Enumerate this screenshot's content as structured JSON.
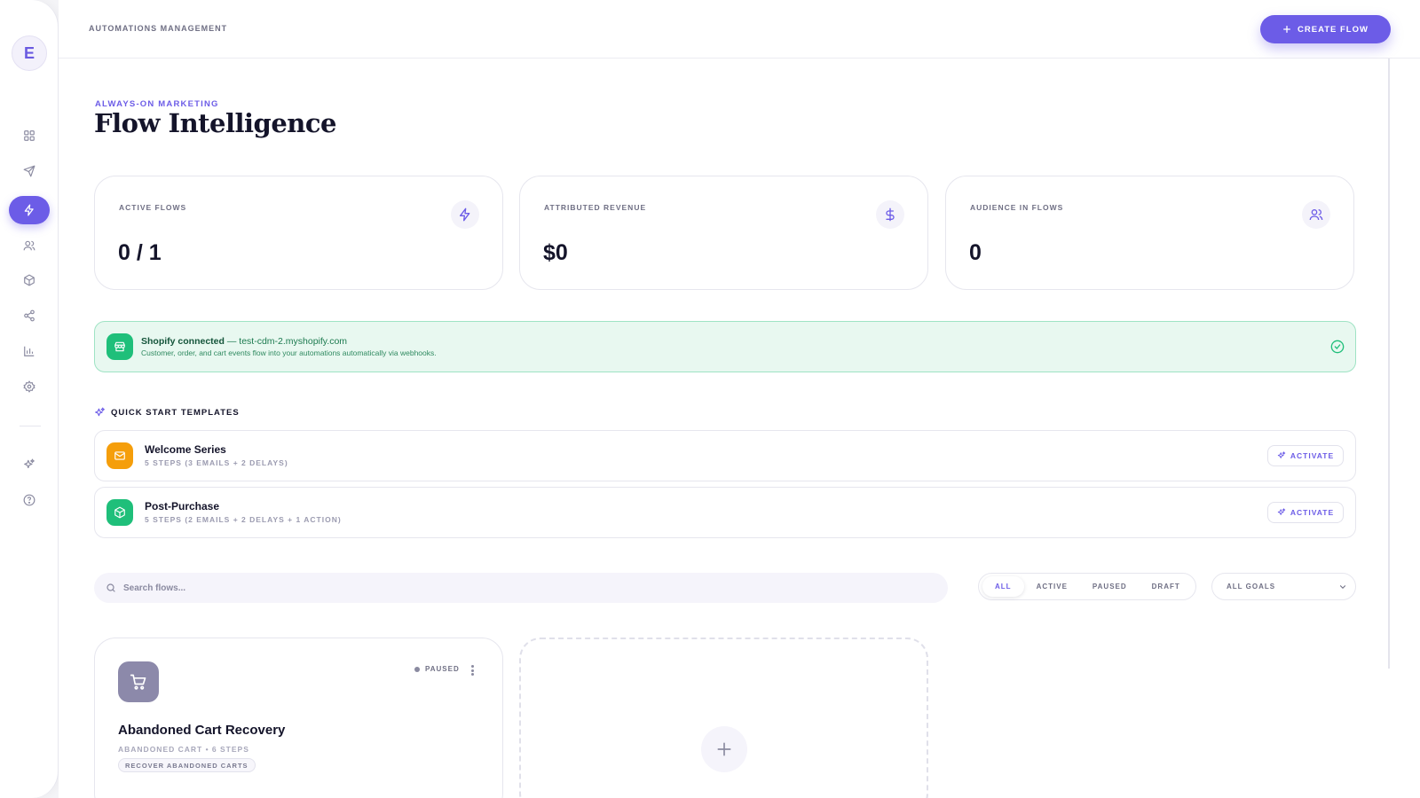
{
  "sidebar": {
    "avatar_letter": "E",
    "items": [
      {
        "name": "dashboard",
        "icon": "grid-icon"
      },
      {
        "name": "campaigns",
        "icon": "send-icon"
      },
      {
        "name": "automations",
        "icon": "bolt-icon",
        "active": true
      },
      {
        "name": "audience",
        "icon": "users-icon"
      },
      {
        "name": "products",
        "icon": "box-icon"
      },
      {
        "name": "integrations",
        "icon": "share-icon"
      },
      {
        "name": "analytics",
        "icon": "bar-chart-icon"
      },
      {
        "name": "settings",
        "icon": "gear-icon"
      },
      {
        "name": "ai",
        "icon": "sparkles-icon"
      },
      {
        "name": "help",
        "icon": "help-circle-icon"
      }
    ]
  },
  "header": {
    "title": "AUTOMATIONS MANAGEMENT",
    "create_label": "CREATE FLOW"
  },
  "page": {
    "eyebrow": "ALWAYS-ON MARKETING",
    "title": "Flow Intelligence"
  },
  "stats": [
    {
      "label": "ACTIVE FLOWS",
      "value": "0 / 1",
      "icon": "bolt-icon"
    },
    {
      "label": "ATTRIBUTED REVENUE",
      "value": "$0",
      "icon": "dollar-icon"
    },
    {
      "label": "AUDIENCE IN FLOWS",
      "value": "0",
      "icon": "users-icon"
    }
  ],
  "shopify": {
    "status": "Shopify connected",
    "domain": "— test-cdm-2.myshopify.com",
    "description": "Customer, order, and cart events flow into your automations automatically via webhooks."
  },
  "templates": {
    "section_title": "QUICK START TEMPLATES",
    "items": [
      {
        "name": "Welcome Series",
        "meta": "5 STEPS (3 EMAILS + 2 DELAYS)",
        "action": "ACTIVATE",
        "color": "#f59e0b",
        "icon": "mail-icon"
      },
      {
        "name": "Post-Purchase",
        "meta": "5 STEPS (2 EMAILS + 2 DELAYS + 1 ACTION)",
        "action": "ACTIVATE",
        "color": "#1fbf7a",
        "icon": "box-icon"
      }
    ]
  },
  "filters": {
    "search_placeholder": "Search flows...",
    "tabs": [
      "ALL",
      "ACTIVE",
      "PAUSED",
      "DRAFT"
    ],
    "active_tab": "ALL",
    "goal_select": "ALL GOALS"
  },
  "flows": [
    {
      "name": "Abandoned Cart Recovery",
      "meta": "ABANDONED CART • 6 STEPS",
      "goal": "RECOVER ABANDONED CARTS",
      "status": "PAUSED",
      "icon": "cart-icon"
    }
  ],
  "colors": {
    "accent": "#6c5ce7",
    "success": "#1fbf7a",
    "warning": "#f59e0b"
  }
}
